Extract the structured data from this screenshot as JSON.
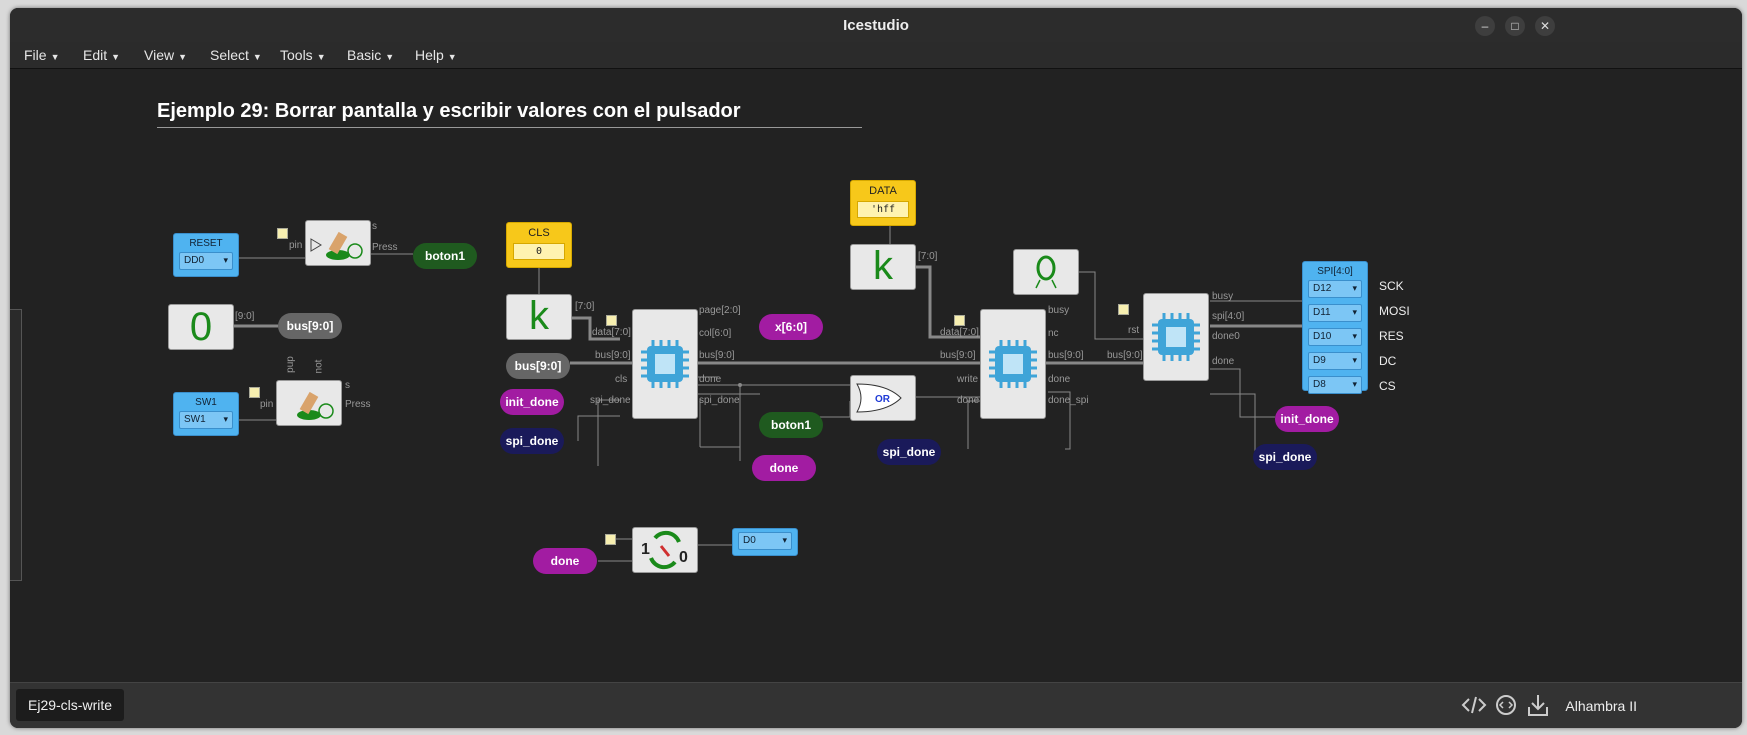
{
  "window": {
    "title": "Icestudio",
    "min_icon": "minimize-icon",
    "max_icon": "maximize-icon",
    "close_icon": "close-icon"
  },
  "menu": [
    "File",
    "Edit",
    "View",
    "Select",
    "Tools",
    "Basic",
    "Help"
  ],
  "heading": "Ejemplo 29: Borrar pantalla y escribir valores con el pulsador",
  "blocks": {
    "reset": {
      "title": "RESET",
      "pin": "DD0"
    },
    "sw1": {
      "title": "SW1",
      "pin": "SW1"
    },
    "zero_const": "0",
    "cls": {
      "title": "CLS",
      "value": "0"
    },
    "data": {
      "title": "DATA",
      "value": "'hff"
    },
    "k": "k",
    "spi": {
      "title": "SPI[4:0]",
      "pins": [
        "D12",
        "D11",
        "D10",
        "D9",
        "D8"
      ],
      "outputs": [
        "SCK",
        "MOSI",
        "RES",
        "DC",
        "CS"
      ]
    },
    "d0": "D0",
    "or_label": "OR",
    "toggle_1": "1",
    "toggle_0": "0"
  },
  "labels": {
    "boton1_a": "boton1",
    "boton1_b": "boton1",
    "bus_a": "bus[9:0]",
    "bus_b": "bus[9:0]",
    "x60": "x[6:0]",
    "init_done_a": "init_done",
    "init_done_b": "init_done",
    "spi_done_a": "spi_done",
    "spi_done_b": "spi_done",
    "spi_done_c": "spi_done",
    "done_a": "done",
    "done_b": "done"
  },
  "ports": {
    "pin1": "pin",
    "s1": "s",
    "press1": "Press",
    "pin2": "pin",
    "s2": "s",
    "press2": "Press",
    "pup": "pup",
    "not": "not",
    "b90": "[9:0]",
    "b70a": "[7:0]",
    "b70b": "[7:0]",
    "data70a": "data[7:0]",
    "cls": "cls",
    "bus90a": "bus[9:0]",
    "spidone_in": "spi_done",
    "page20": "page[2:0]",
    "col60": "col[6:0]",
    "bus90b": "bus[9:0]",
    "done1": "done",
    "spidone_out": "spi_done",
    "data70b": "data[7:0]",
    "bus90c": "bus[9:0]",
    "write": "write",
    "done2": "done",
    "busy1": "busy",
    "nc": "nc",
    "bus90d": "bus[9:0]",
    "done3": "done",
    "done_spi": "done_spi",
    "bus90e": "bus[9:0]",
    "rst": "rst",
    "busy2": "busy",
    "spi40": "spi[4:0]",
    "done0": "done0",
    "done4": "done"
  },
  "status": {
    "tab": "Ej29-cls-write",
    "board": "Alhambra II",
    "icons": [
      "code-icon",
      "settings-icon",
      "download-icon"
    ]
  }
}
